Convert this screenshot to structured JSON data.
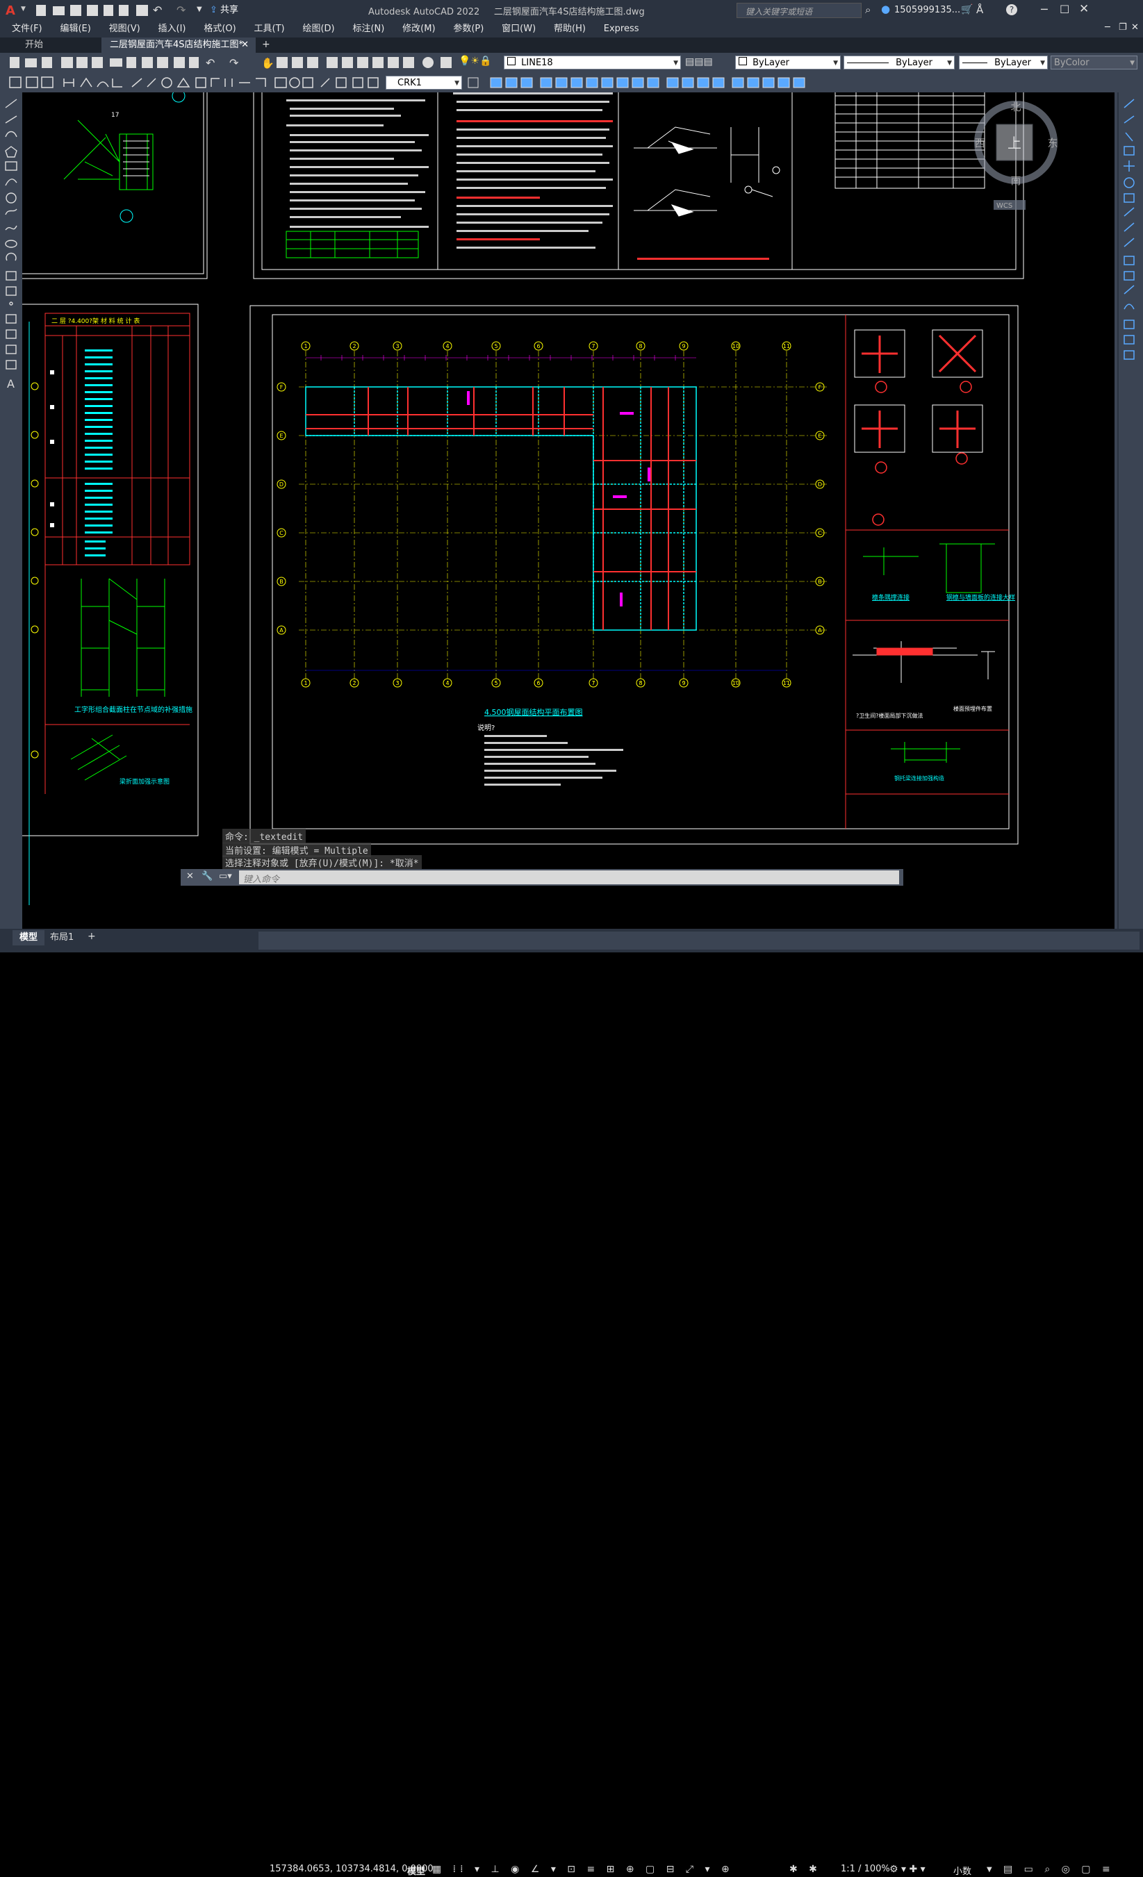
{
  "titlebar": {
    "app_title": "Autodesk AutoCAD 2022",
    "file_title": "二层钢屋面汽车4S店结构施工图.dwg",
    "share_label": "共享",
    "search_placeholder": "键入关键字或短语",
    "user_name": "1505999135..."
  },
  "menu": [
    "文件(F)",
    "编辑(E)",
    "视图(V)",
    "插入(I)",
    "格式(O)",
    "工具(T)",
    "绘图(D)",
    "标注(N)",
    "修改(M)",
    "参数(P)",
    "窗口(W)",
    "帮助(H)",
    "Express"
  ],
  "tabs": {
    "start": "开始",
    "active": "二层钢屋面汽车4S店结构施工图*",
    "add": "+"
  },
  "toolbar": {
    "layer_name": "LINE18",
    "color": "ByLayer",
    "linetype": "ByLayer",
    "lineweight": "ByLayer",
    "plotstyle": "ByColor",
    "dimstyle": "CRK1"
  },
  "viewcube": {
    "north": "北",
    "south": "南",
    "east": "东",
    "west": "西",
    "top": "上",
    "wcs": "WCS"
  },
  "drawing": {
    "table_title": "二 层 ?4.400?架  材 料 统 计 表",
    "plan_title": "4.500钢屋面结构平面布置图",
    "notes_title": "说明?",
    "detail_title_1": "工字形组合截面柱在节点域的补强措施",
    "detail_title_2": "梁折面加强示意图",
    "right_title_1": "檩条隅撑连接",
    "right_title_2": "钢檩与墙面板的连接大样",
    "right_title_3": "?卫生间?楼面局部下沉做法",
    "right_title_4": "楼面预埋件布置",
    "right_title_5": "钢托梁连接加强构造",
    "grid_cols": [
      "1",
      "2",
      "3",
      "4",
      "5",
      "6",
      "7",
      "8",
      "9",
      "10",
      "11"
    ],
    "grid_rows": [
      "F",
      "E",
      "D",
      "C",
      "B",
      "A"
    ]
  },
  "command": {
    "line1": "命令: _textedit",
    "line2": "当前设置: 编辑模式 = Multiple",
    "line3": "选择注释对象或 [放弃(U)/模式(M)]: *取消*",
    "placeholder": "键入命令"
  },
  "layout_tabs": {
    "model": "模型",
    "layout1": "布局1",
    "add": "+"
  },
  "status": {
    "coords": "157384.0653, 103734.4814, 0.0000",
    "mode": "模型",
    "scale": "1:1 / 100%",
    "units": "小数"
  },
  "colors": {
    "accent": "#3a8ee6",
    "chrome": "#2b3340",
    "toolbar": "#3b4453",
    "canvas": "#000000"
  }
}
